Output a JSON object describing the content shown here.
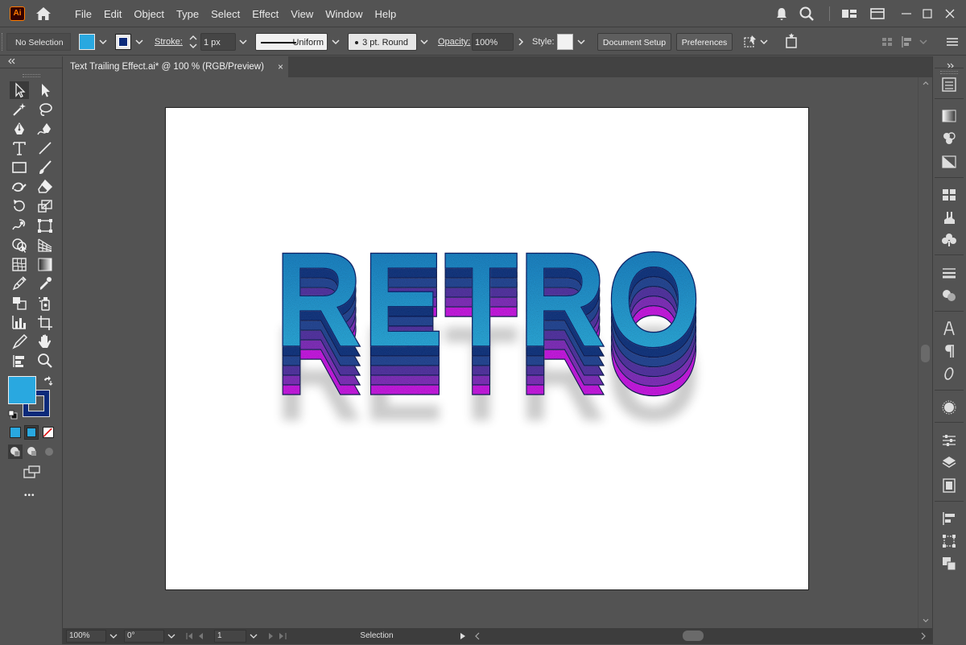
{
  "app": {
    "logo_text": "Ai"
  },
  "menu": [
    "File",
    "Edit",
    "Object",
    "Type",
    "Select",
    "Effect",
    "View",
    "Window",
    "Help"
  ],
  "control": {
    "selection_label": "No Selection",
    "stroke_label": "Stroke:",
    "stroke_weight": "1 px",
    "stroke_profile": "Uniform",
    "brush": "3 pt. Round",
    "opacity_label": "Opacity:",
    "opacity_value": "100%",
    "style_label": "Style:",
    "document_setup": "Document Setup",
    "preferences": "Preferences"
  },
  "colors": {
    "fill": "#29a8e0",
    "stroke": "#0b2a7a",
    "retro_top": "#2dafe0",
    "retro_layers": [
      "#163c8a",
      "#2a4ea0",
      "#5b3aae",
      "#8a35c8",
      "#d41ef0"
    ]
  },
  "document": {
    "tab_title": "Text Trailing Effect.ai* @ 100 % (RGB/Preview)",
    "close_glyph": "×"
  },
  "artwork": {
    "text": "RETRO"
  },
  "status": {
    "zoom": "100%",
    "rotation": "0°",
    "artboard_number": "1",
    "tool_name": "Selection"
  },
  "toolbox": {
    "more_glyph": "•••"
  }
}
